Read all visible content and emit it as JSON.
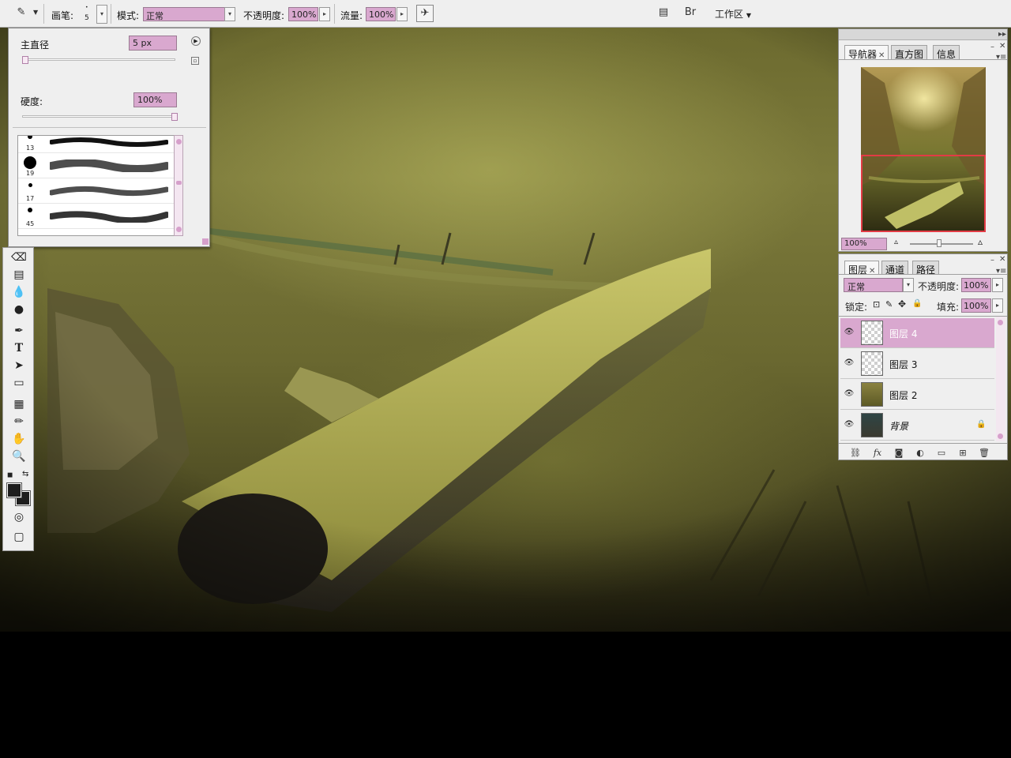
{
  "options_bar": {
    "brush_label": "画笔:",
    "brush_size": "5",
    "mode_label": "模式:",
    "mode_value": "正常",
    "opacity_label": "不透明度:",
    "opacity_value": "100%",
    "flow_label": "流量:",
    "flow_value": "100%",
    "workspace_label": "工作区"
  },
  "brush_popup": {
    "master_diameter_label": "主直径",
    "master_diameter_value": "5 px",
    "hardness_label": "硬度:",
    "hardness_value": "100%",
    "brushes": [
      {
        "size": "13"
      },
      {
        "size": "19"
      },
      {
        "size": "17"
      },
      {
        "size": "45"
      }
    ]
  },
  "navigator": {
    "tabs": [
      "导航器",
      "直方图",
      "信息"
    ],
    "zoom": "100%"
  },
  "layers_panel": {
    "tabs": [
      "图层",
      "通道",
      "路径"
    ],
    "blend_mode": "正常",
    "opacity_label": "不透明度:",
    "opacity_value": "100%",
    "lock_label": "锁定:",
    "fill_label": "填充:",
    "fill_value": "100%",
    "layers": [
      {
        "name": "图层 4",
        "selected": true
      },
      {
        "name": "图层 3",
        "selected": false
      },
      {
        "name": "图层 2",
        "selected": false
      },
      {
        "name": "背景",
        "selected": false,
        "locked": true
      }
    ]
  },
  "colors": {
    "accent": "#d9a8cf",
    "nav_frame": "#e23b45",
    "foreground": "#1e1e1e",
    "background": "#1e1e1e"
  }
}
